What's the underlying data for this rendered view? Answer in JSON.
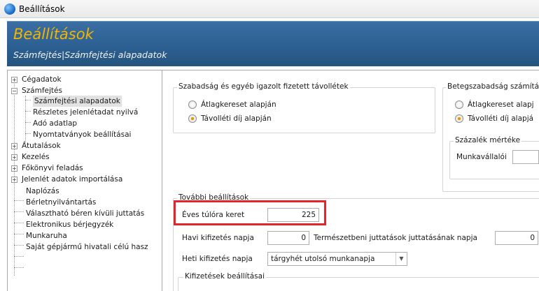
{
  "window": {
    "title": "Beállítások"
  },
  "header": {
    "title": "Beállítások",
    "breadcrumb": "Számfejtés|Számfejtési alapadatok"
  },
  "sidebar": {
    "items": [
      {
        "label": "Cégadatok",
        "expander": "+"
      },
      {
        "label": "Számfejtés",
        "expander": "−"
      },
      {
        "label": "Számfejtési alapadatok"
      },
      {
        "label": "Részletes jelenlétadat nyilvá"
      },
      {
        "label": "Adó adatlap"
      },
      {
        "label": "Nyomtatványok beállításai"
      },
      {
        "label": "Átutalások",
        "expander": "+"
      },
      {
        "label": "Kezelés",
        "expander": "+"
      },
      {
        "label": "Főkönyvi feladás",
        "expander": "+"
      },
      {
        "label": "Jelenlét adatok importálása",
        "expander": "+"
      },
      {
        "label": "Naplózás"
      },
      {
        "label": "Bérletnyilvántartás"
      },
      {
        "label": "Választható béren kívüli juttatás"
      },
      {
        "label": "Elektronikus bérjegyzék"
      },
      {
        "label": "Munkaruha"
      },
      {
        "label": "Saját gépjármű hivatali célú hasz"
      }
    ]
  },
  "main": {
    "absence_group": {
      "label": "Szabadság és egyéb igazolt fizetett távollétek",
      "option_average": "Átlagkereset alapján",
      "option_absence_fee": "Távolléti díj alapján"
    },
    "sick_group": {
      "label": "Betegszabadság számítá",
      "option_average": "Átlagkereset alapj",
      "option_absence_fee": "Távolléti díj alapjá",
      "percent_group_label": "Százalék mértéke",
      "employee_label": "Munkavállalói"
    },
    "extra_group": {
      "label": "További beállítások",
      "overtime_label": "Éves túlóra keret",
      "overtime_value": "225",
      "monthly_pay_day_label": "Havi kifizetés napja",
      "monthly_pay_day_value": "0",
      "in_kind_label": "Természetbeni juttatások juttatásának napja",
      "in_kind_value": "0",
      "weekly_pay_day_label": "Heti kifizetés napja",
      "weekly_pay_day_value": "tárgyhét utolsó munkanapja",
      "payments_group_label": "Kifizetések beállításai"
    }
  },
  "colors": {
    "banner": "#2c5f92",
    "banner_title": "#f4b400",
    "highlight": "#e3242b",
    "radio_selected": "#e59a00"
  }
}
